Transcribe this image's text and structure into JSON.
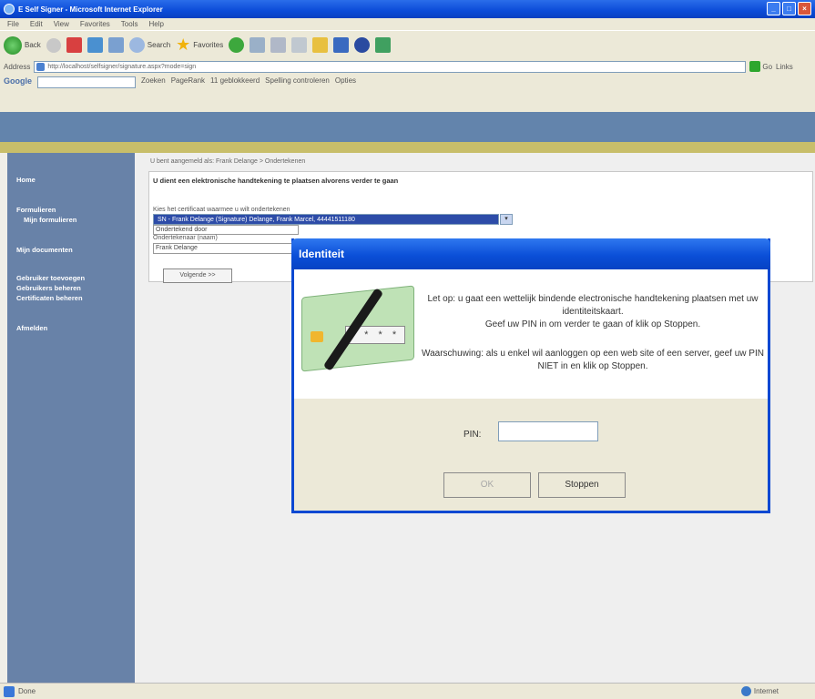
{
  "browser": {
    "title": "E Self Signer - Microsoft Internet Explorer",
    "menu": [
      "File",
      "Edit",
      "View",
      "Favorites",
      "Tools",
      "Help"
    ],
    "toolbar": {
      "back_label": "Back",
      "search_label": "Search",
      "favorites_label": "Favorites"
    },
    "address": {
      "label": "Address",
      "url": "http://localhost/selfsigner/signature.aspx?mode=sign",
      "go_label": "Go",
      "links_label": "Links"
    },
    "google": {
      "logo": "Google",
      "search_label": "Zoeken",
      "pagerank_label": "PageRank",
      "blocked_label": "11 geblokkeerd",
      "spellcheck_label": "Spelling controleren",
      "options_label": "Opties"
    },
    "status": {
      "left": "Done",
      "zone": "Internet"
    }
  },
  "sidebar": {
    "items": [
      {
        "label": "Home",
        "indent": false
      },
      {
        "label": "Formulieren",
        "indent": false
      },
      {
        "label": "Mijn formulieren",
        "indent": true
      },
      {
        "label": "Mijn documenten",
        "indent": false
      },
      {
        "label": "Gebruiker toevoegen",
        "indent": false
      },
      {
        "label": "Gebruikers beheren",
        "indent": false
      },
      {
        "label": "Certificaten beheren",
        "indent": false
      },
      {
        "label": "Afmelden",
        "indent": false
      }
    ]
  },
  "main": {
    "breadcrumb": "U bent aangemeld als: Frank Delange > Ondertekenen",
    "title": "U dient een elektronische handtekening te plaatsen alvorens verder te gaan",
    "cert_label": "Kies het certificaat waarmee u wilt ondertekenen",
    "cert_value": "SN - Frank Delange (Signature) Delange, Frank Marcel, 44441511180",
    "field1": "Ondertekend door",
    "field1_label": "Ondertekenaar (naam)",
    "field2": "Frank Delange",
    "next_button": "Volgende >>"
  },
  "dialog": {
    "title": "Identiteit",
    "message1": "Let op: u gaat een wettelijk bindende electronische handtekening plaatsen met uw identiteitskaart.\nGeef uw PIN in om verder te gaan of klik op Stoppen.",
    "message2": "Waarschuwing: als u enkel wil aanloggen op een web site of een server, geef uw PIN NIET in en klik op Stoppen.",
    "card_pin_mask": "* * * *",
    "pin_label": "PIN:",
    "pin_value": "",
    "ok_label": "OK",
    "stop_label": "Stoppen"
  }
}
